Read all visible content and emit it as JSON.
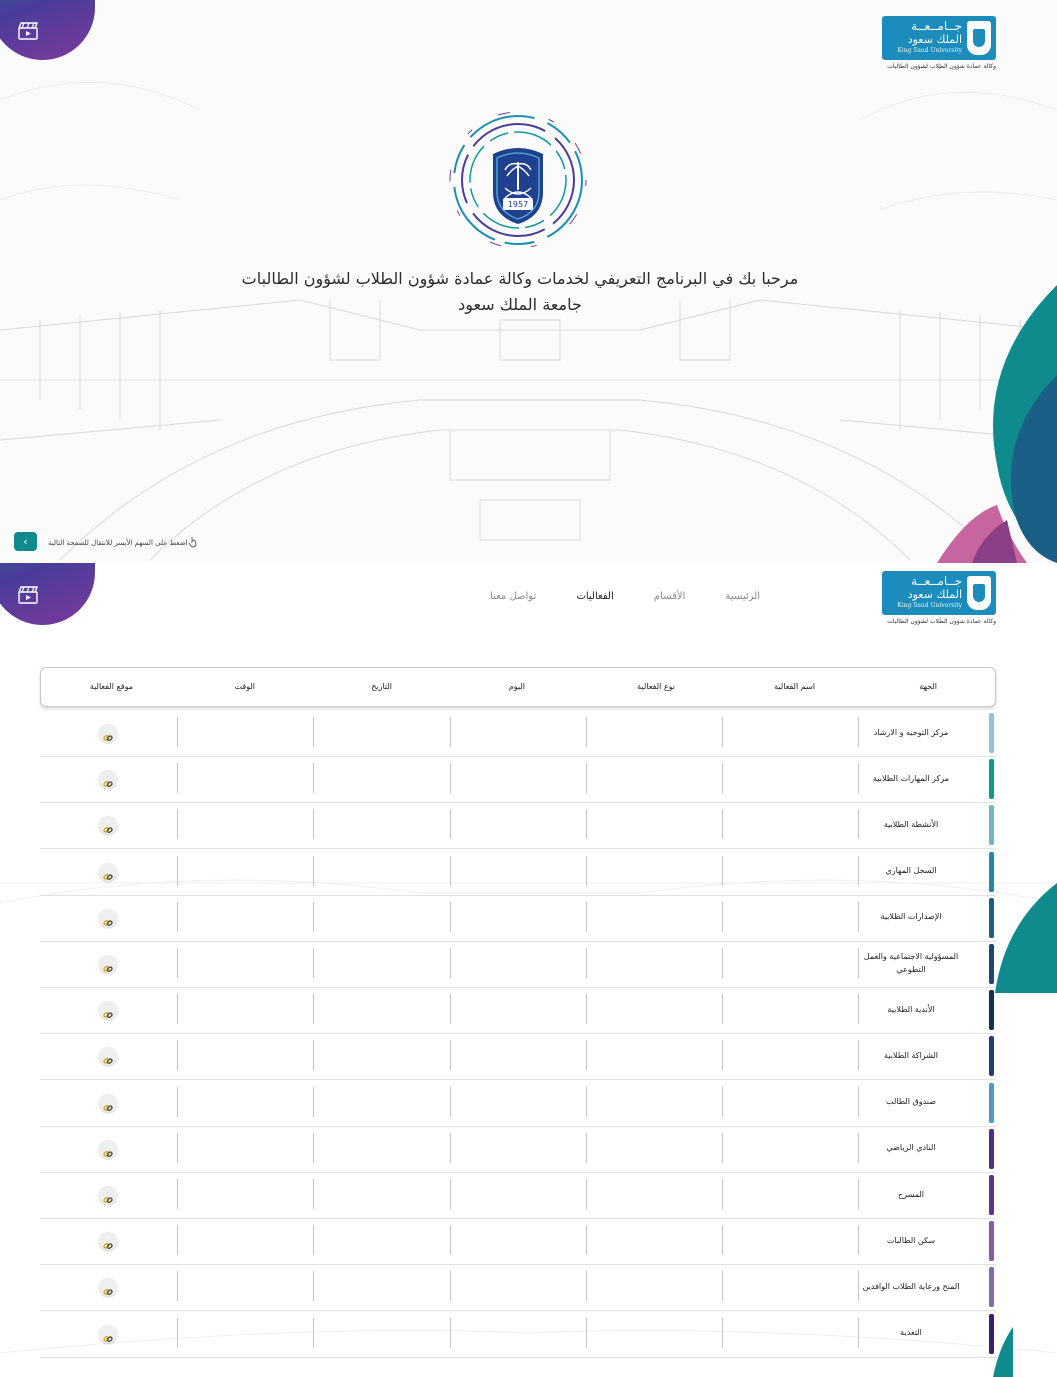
{
  "university": {
    "name_ar_line1": "جــامــعــة",
    "name_ar_line2": "الملك سعود",
    "name_en": "King Saud University",
    "subtitle": "وكالة عمادة شؤون الطلاب لشؤون الطالبات"
  },
  "intro": {
    "emblem_year": "1957",
    "welcome_line1": "مرحبا بك في البرنامج التعريفي لخدمات وكالة عمادة شؤون الطلاب لشؤون الطالبات",
    "welcome_line2": "جامعة الملك سعود",
    "hint": "اضغط على السهم الأيسر للانتقال للصفحة التالية",
    "next_icon": "chevron-right-icon"
  },
  "nav": {
    "items": [
      "الرئيسية",
      "الأقسام",
      "الفعاليات",
      "تواصل معنا"
    ],
    "active": "الفعاليات"
  },
  "table": {
    "columns": [
      "الجهة",
      "اسم الفعالية",
      "نوع الفعالية",
      "اليوم",
      "التاريخ",
      "الوقت",
      "موقع الفعالية"
    ],
    "rows": [
      {
        "name": "مركز التوجيه و الارشاد",
        "color": "#8fc3dd"
      },
      {
        "name": "مركز المهارات الطلابية",
        "color": "#0f9a8e"
      },
      {
        "name": "الأنشطة الطلابية",
        "color": "#6fb7c8"
      },
      {
        "name": "السجل المهاري",
        "color": "#2586a8"
      },
      {
        "name": "الإصدارات الطلابية",
        "color": "#1c5f86"
      },
      {
        "name": "المسؤولية الاجتماعية والعمل التطوعي",
        "color": "#20466e"
      },
      {
        "name": "الأندية الطلابية",
        "color": "#15314f"
      },
      {
        "name": "الشراكة الطلابية",
        "color": "#283a7a"
      },
      {
        "name": "صندوق الطالب",
        "color": "#4a9cc8"
      },
      {
        "name": "النادي الرياضي",
        "color": "#4a2f86"
      },
      {
        "name": "المسرح",
        "color": "#5a3590"
      },
      {
        "name": "سكن الطالبات",
        "color": "#8a5aa6"
      },
      {
        "name": "المنح ورعاية الطلاب الوافدين",
        "color": "#7e6db0"
      },
      {
        "name": "التغذية",
        "color": "#3a1f6e"
      }
    ],
    "link_icon": "link-icon"
  },
  "colors": {
    "teal": "#0f8a8d",
    "purple": "#6a3f9e",
    "pink": "#c7659f",
    "brand_blue": "#1b8cbc"
  }
}
